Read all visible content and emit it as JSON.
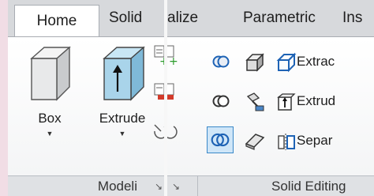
{
  "home_ribbon": {
    "tabs": [
      "Home",
      "Solid"
    ],
    "buttons": [
      {
        "label": "Box",
        "icon": "box-icon"
      },
      {
        "label": "Extrude",
        "icon": "extrude-icon"
      }
    ],
    "panel_title": "Modeli"
  },
  "parametric_ribbon": {
    "tabs": [
      "alize",
      "Parametric",
      "Ins"
    ],
    "commands": [
      {
        "label": "Extrac"
      },
      {
        "label": "Extrud"
      },
      {
        "label": "Separ"
      }
    ],
    "panel_title": "Solid Editing",
    "launcher_glyph": "↘"
  },
  "colors": {
    "tab_bar": "#d7d9dc",
    "selection_border": "#3a88c8",
    "selection_fill": "#cfe6f8",
    "icon_blue": "#1e63b5"
  }
}
